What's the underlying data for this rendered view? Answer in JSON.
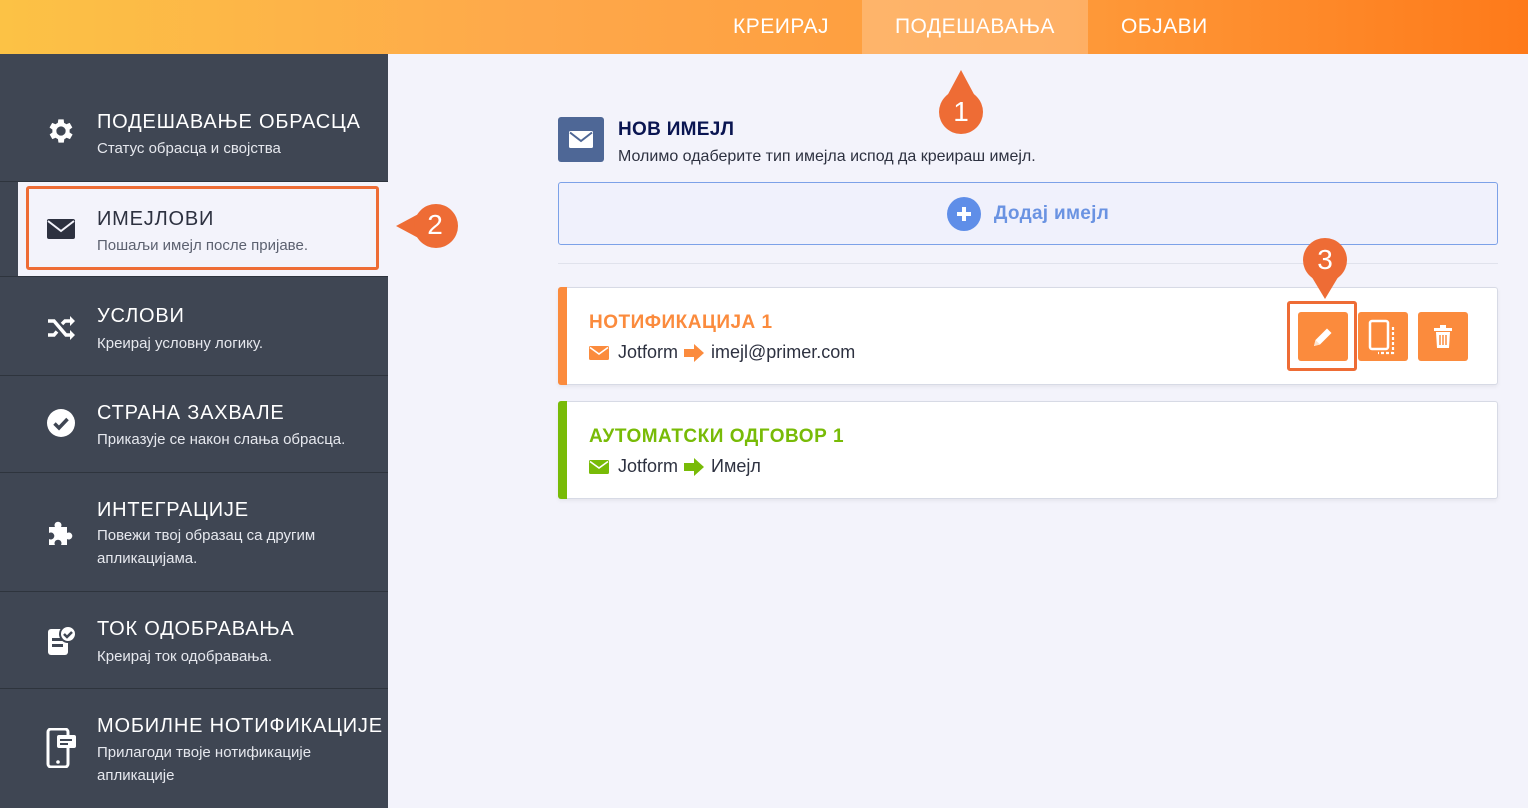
{
  "topnav": {
    "tabs": [
      {
        "label": "КРЕИРАЈ"
      },
      {
        "label": "ПОДЕШАВАЊА"
      },
      {
        "label": "ОБЈАВИ"
      }
    ],
    "active_tab": "ПОДЕШАВАЊА"
  },
  "sidebar": {
    "items": [
      {
        "title": "ПОДЕШАВАЊЕ ОБРАСЦА",
        "desc": "Статус обрасца и својства",
        "icon": "gear-icon"
      },
      {
        "title": "ИМЕЈЛОВИ",
        "desc": "Пошаљи имејл после пријаве.",
        "icon": "envelope-icon"
      },
      {
        "title": "УСЛОВИ",
        "desc": "Креирај условну логику.",
        "icon": "shuffle-icon"
      },
      {
        "title": "СТРАНА ЗАХВАЛЕ",
        "desc": "Приказује се након слања обрасца.",
        "icon": "check-circle-icon"
      },
      {
        "title": "ИНТЕГРАЦИЈЕ",
        "desc": "Повежи твој образац са другим апликацијама.",
        "icon": "puzzle-icon"
      },
      {
        "title": "ТОК ОДОБРАВАЊА",
        "desc": "Креирај ток одобравања.",
        "icon": "approval-flow-icon"
      },
      {
        "title": "МОБИЛНЕ НОТИФИКАЦИЈЕ",
        "desc": "Прилагоди твоје нотификације апликације",
        "icon": "mobile-notification-icon"
      }
    ],
    "active_index": 1
  },
  "main": {
    "new_email": {
      "title": "НОВ ИМЕЈЛ",
      "subtitle": "Молимо одаберите тип имејла испод да креираш имејл."
    },
    "add_button": "Додај имејл",
    "emails": [
      {
        "title": "НОТИФИКАЦИЈА 1",
        "from": "Jotform",
        "to": "imejl@primer.com",
        "color": "#fb8b3d"
      },
      {
        "title": "АУТОМАТСКИ ОДГОВОР 1",
        "from": "Jotform",
        "to": "Имејл",
        "color": "#78bb07"
      }
    ]
  },
  "callouts": [
    "1",
    "2",
    "3"
  ],
  "colors": {
    "accent_orange": "#fb8b3d",
    "callout": "#ee6c35",
    "autoresponder_green": "#78bb07",
    "sidebar_bg": "#3f4653",
    "add_button_blue": "#6a93e2"
  }
}
